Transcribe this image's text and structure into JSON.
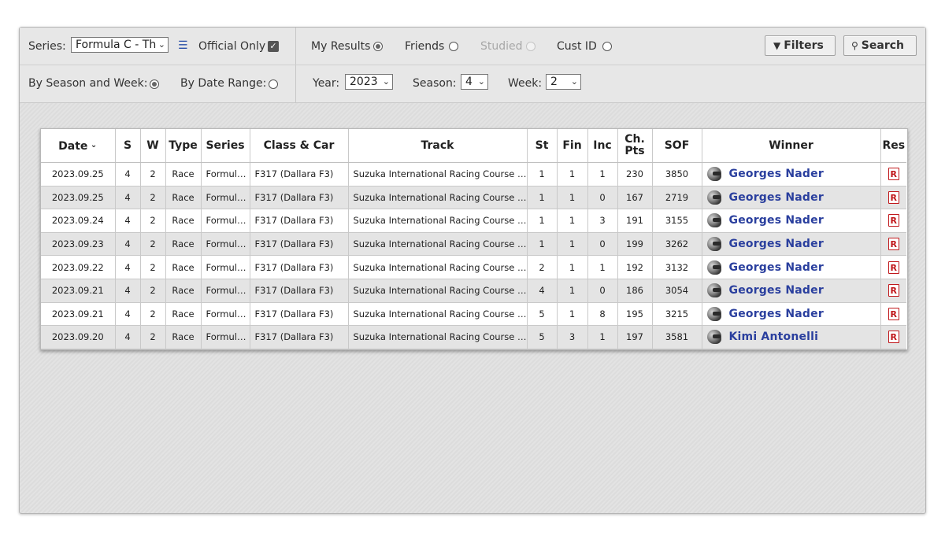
{
  "toolbar": {
    "series_label": "Series:",
    "series_value": "Formula C - Th",
    "official_only_label": "Official Only",
    "my_results_label": "My Results",
    "friends_label": "Friends",
    "studied_label": "Studied",
    "cust_id_label": "Cust ID",
    "filters_label": "Filters",
    "search_label": "Search",
    "by_season_week_label": "By Season and Week:",
    "by_date_range_label": "By Date Range:",
    "year_label": "Year:",
    "year_value": "2023",
    "season_label": "Season:",
    "season_value": "4",
    "week_label": "Week:",
    "week_value": "2"
  },
  "table": {
    "headers": {
      "date": "Date",
      "s": "S",
      "w": "W",
      "type": "Type",
      "series": "Series",
      "class_car": "Class & Car",
      "track": "Track",
      "st": "St",
      "fin": "Fin",
      "inc": "Inc",
      "ch_pts_1": "Ch.",
      "ch_pts_2": "Pts",
      "sof": "SOF",
      "winner": "Winner",
      "res": "Res"
    },
    "res_icon_text": "R",
    "rows": [
      {
        "date": "2023.09.25",
        "s": "4",
        "w": "2",
        "type": "Race",
        "series": "Formula C - The Dallara",
        "car": "F317 (Dallara F3)",
        "track": "Suzuka International Racing Course - Grand Prix",
        "st": "1",
        "fin": "1",
        "inc": "1",
        "pts": "230",
        "sof": "3850",
        "winner": "Georges Nader"
      },
      {
        "date": "2023.09.25",
        "s": "4",
        "w": "2",
        "type": "Race",
        "series": "Formula C - The Dallara",
        "car": "F317 (Dallara F3)",
        "track": "Suzuka International Racing Course - Grand Prix",
        "st": "1",
        "fin": "1",
        "inc": "0",
        "pts": "167",
        "sof": "2719",
        "winner": "Georges Nader"
      },
      {
        "date": "2023.09.24",
        "s": "4",
        "w": "2",
        "type": "Race",
        "series": "Formula C - The Dallara",
        "car": "F317 (Dallara F3)",
        "track": "Suzuka International Racing Course - Grand Prix",
        "st": "1",
        "fin": "1",
        "inc": "3",
        "pts": "191",
        "sof": "3155",
        "winner": "Georges Nader"
      },
      {
        "date": "2023.09.23",
        "s": "4",
        "w": "2",
        "type": "Race",
        "series": "Formula C - The Dallara",
        "car": "F317 (Dallara F3)",
        "track": "Suzuka International Racing Course - Grand Prix",
        "st": "1",
        "fin": "1",
        "inc": "0",
        "pts": "199",
        "sof": "3262",
        "winner": "Georges Nader"
      },
      {
        "date": "2023.09.22",
        "s": "4",
        "w": "2",
        "type": "Race",
        "series": "Formula C - The Dallara",
        "car": "F317 (Dallara F3)",
        "track": "Suzuka International Racing Course - Grand Prix",
        "st": "2",
        "fin": "1",
        "inc": "1",
        "pts": "192",
        "sof": "3132",
        "winner": "Georges Nader"
      },
      {
        "date": "2023.09.21",
        "s": "4",
        "w": "2",
        "type": "Race",
        "series": "Formula C - The Dallara",
        "car": "F317 (Dallara F3)",
        "track": "Suzuka International Racing Course - Grand Prix",
        "st": "4",
        "fin": "1",
        "inc": "0",
        "pts": "186",
        "sof": "3054",
        "winner": "Georges Nader"
      },
      {
        "date": "2023.09.21",
        "s": "4",
        "w": "2",
        "type": "Race",
        "series": "Formula C - The Dallara",
        "car": "F317 (Dallara F3)",
        "track": "Suzuka International Racing Course - Grand Prix",
        "st": "5",
        "fin": "1",
        "inc": "8",
        "pts": "195",
        "sof": "3215",
        "winner": "Georges Nader"
      },
      {
        "date": "2023.09.20",
        "s": "4",
        "w": "2",
        "type": "Race",
        "series": "Formula C - The Dallara",
        "car": "F317 (Dallara F3)",
        "track": "Suzuka International Racing Course - Grand Prix",
        "st": "5",
        "fin": "3",
        "inc": "1",
        "pts": "197",
        "sof": "3581",
        "winner": "Kimi Antonelli"
      }
    ]
  }
}
